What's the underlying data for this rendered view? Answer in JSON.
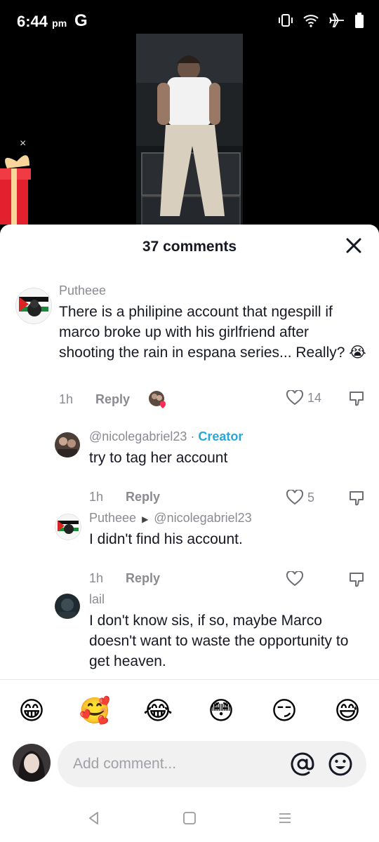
{
  "status": {
    "time": "6:44",
    "ampm": "pm",
    "carrier_icon": "google-g-icon"
  },
  "video": {
    "close_glyph": "×"
  },
  "sheet": {
    "title": "37 comments"
  },
  "comments": [
    {
      "user": "Putheee",
      "text": "There is a philipine account that ngespill if marco broke up with his girlfriend after shooting the rain in espana series... Really? 😭",
      "time": "1h",
      "reply_label": "Reply",
      "likes": "14"
    },
    {
      "user": "@nicolegabriel23",
      "separator": " · ",
      "badge": "Creator",
      "text": "try to tag her account",
      "time": "1h",
      "reply_label": "Reply",
      "likes": "5"
    },
    {
      "user": "Putheee",
      "reply_to": "@nicolegabriel23",
      "text": "I didn't find his account.",
      "time": "1h",
      "reply_label": "Reply",
      "likes": ""
    },
    {
      "user": "lail",
      "text": "I don't know sis, if so, maybe Marco doesn't want to waste the opportunity to get heaven."
    }
  ],
  "emojis": [
    "😁",
    "🥰",
    "😂",
    "😳",
    "😏",
    "😅"
  ],
  "input": {
    "placeholder": "Add comment..."
  },
  "colors": {
    "creator": "#2aa7d6",
    "text": "#161823",
    "muted": "#8a8b91"
  }
}
